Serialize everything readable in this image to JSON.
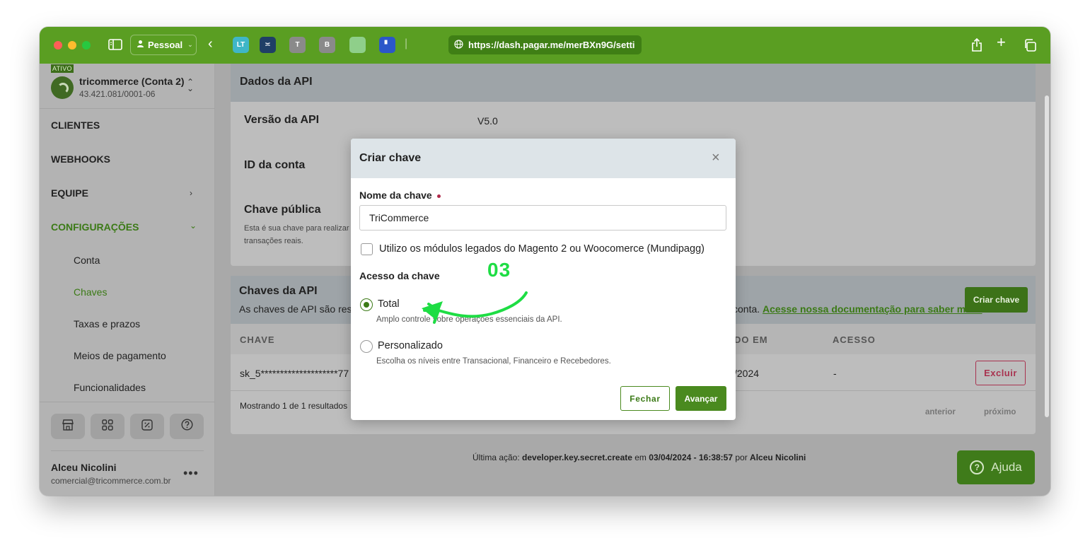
{
  "browser": {
    "profile_label": "Pessoal",
    "url": "https://dash.pagar.me/merBXn9G/setti",
    "tabs": [
      {
        "label": "LT",
        "color": "#3fb6c7"
      },
      {
        "label": "",
        "color": "#1f3f66"
      },
      {
        "label": "T",
        "color": "#8a8a8a"
      },
      {
        "label": "B",
        "color": "#8a8a8a"
      },
      {
        "label": "",
        "color": "#8fcf8a"
      },
      {
        "label": "",
        "color": "#2b57c9"
      }
    ]
  },
  "sidebar": {
    "badge": "ATIVO",
    "account_name": "tricommerce (Conta 2)",
    "account_cnpj": "43.421.081/0001-06",
    "nav": [
      {
        "label": "CLIENTES"
      },
      {
        "label": "WEBHOOKS"
      },
      {
        "label": "EQUIPE"
      },
      {
        "label": "CONFIGURAÇÕES"
      }
    ],
    "sub_items": [
      {
        "label": "Conta"
      },
      {
        "label": "Chaves"
      },
      {
        "label": "Taxas e prazos"
      },
      {
        "label": "Meios de pagamento"
      },
      {
        "label": "Funcionalidades"
      }
    ],
    "user_name": "Alceu Nicolini",
    "user_email": "comercial@tricommerce.com.br",
    "more": "•••"
  },
  "api_data": {
    "title": "Dados da API",
    "version_label": "Versão da API",
    "version_value": "V5.0",
    "account_id_label": "ID da conta",
    "public_key_label": "Chave pública",
    "public_key_desc_1": "Esta é sua chave para realizar te",
    "public_key_desc_2": "transações reais."
  },
  "api_keys": {
    "title": "Chaves da API",
    "desc_prefix": "As chaves de API são resp",
    "desc_suffix": "conta.",
    "doc_link": "Acesse nossa documentação para saber mais.",
    "create_button": "Criar chave",
    "columns": [
      "CHAVE",
      "DO EM",
      "ACESSO"
    ],
    "row": {
      "key": "sk_5********************77",
      "date": "/2024",
      "access": "-",
      "delete": "Excluir"
    },
    "showing": "Mostrando 1 de 1 resultados",
    "prev": "anterior",
    "next": "próximo"
  },
  "footer": {
    "prefix": "Última ação: ",
    "action": "developer.key.secret.create",
    "in": " em ",
    "datetime": "03/04/2024 - 16:38:57",
    "by": " por ",
    "user": "Alceu Nicolini"
  },
  "help": {
    "label": "Ajuda"
  },
  "modal": {
    "title": "Criar chave",
    "close": "×",
    "name_label": "Nome da chave",
    "name_value": "TriCommerce",
    "legacy_checkbox": "Utilizo os módulos legados do Magento 2 ou Woocomerce (Mundipagg)",
    "access_label": "Acesso da chave",
    "options": [
      {
        "label": "Total",
        "desc": "Amplo controle sobre operações essenciais da API.",
        "selected": true
      },
      {
        "label": "Personalizado",
        "desc": "Escolha os níveis entre Transacional, Financeiro e Recebedores.",
        "selected": false
      }
    ],
    "close_button": "Fechar",
    "next_button": "Avançar"
  },
  "annotation": {
    "number": "03",
    "color": "#1edd44"
  }
}
